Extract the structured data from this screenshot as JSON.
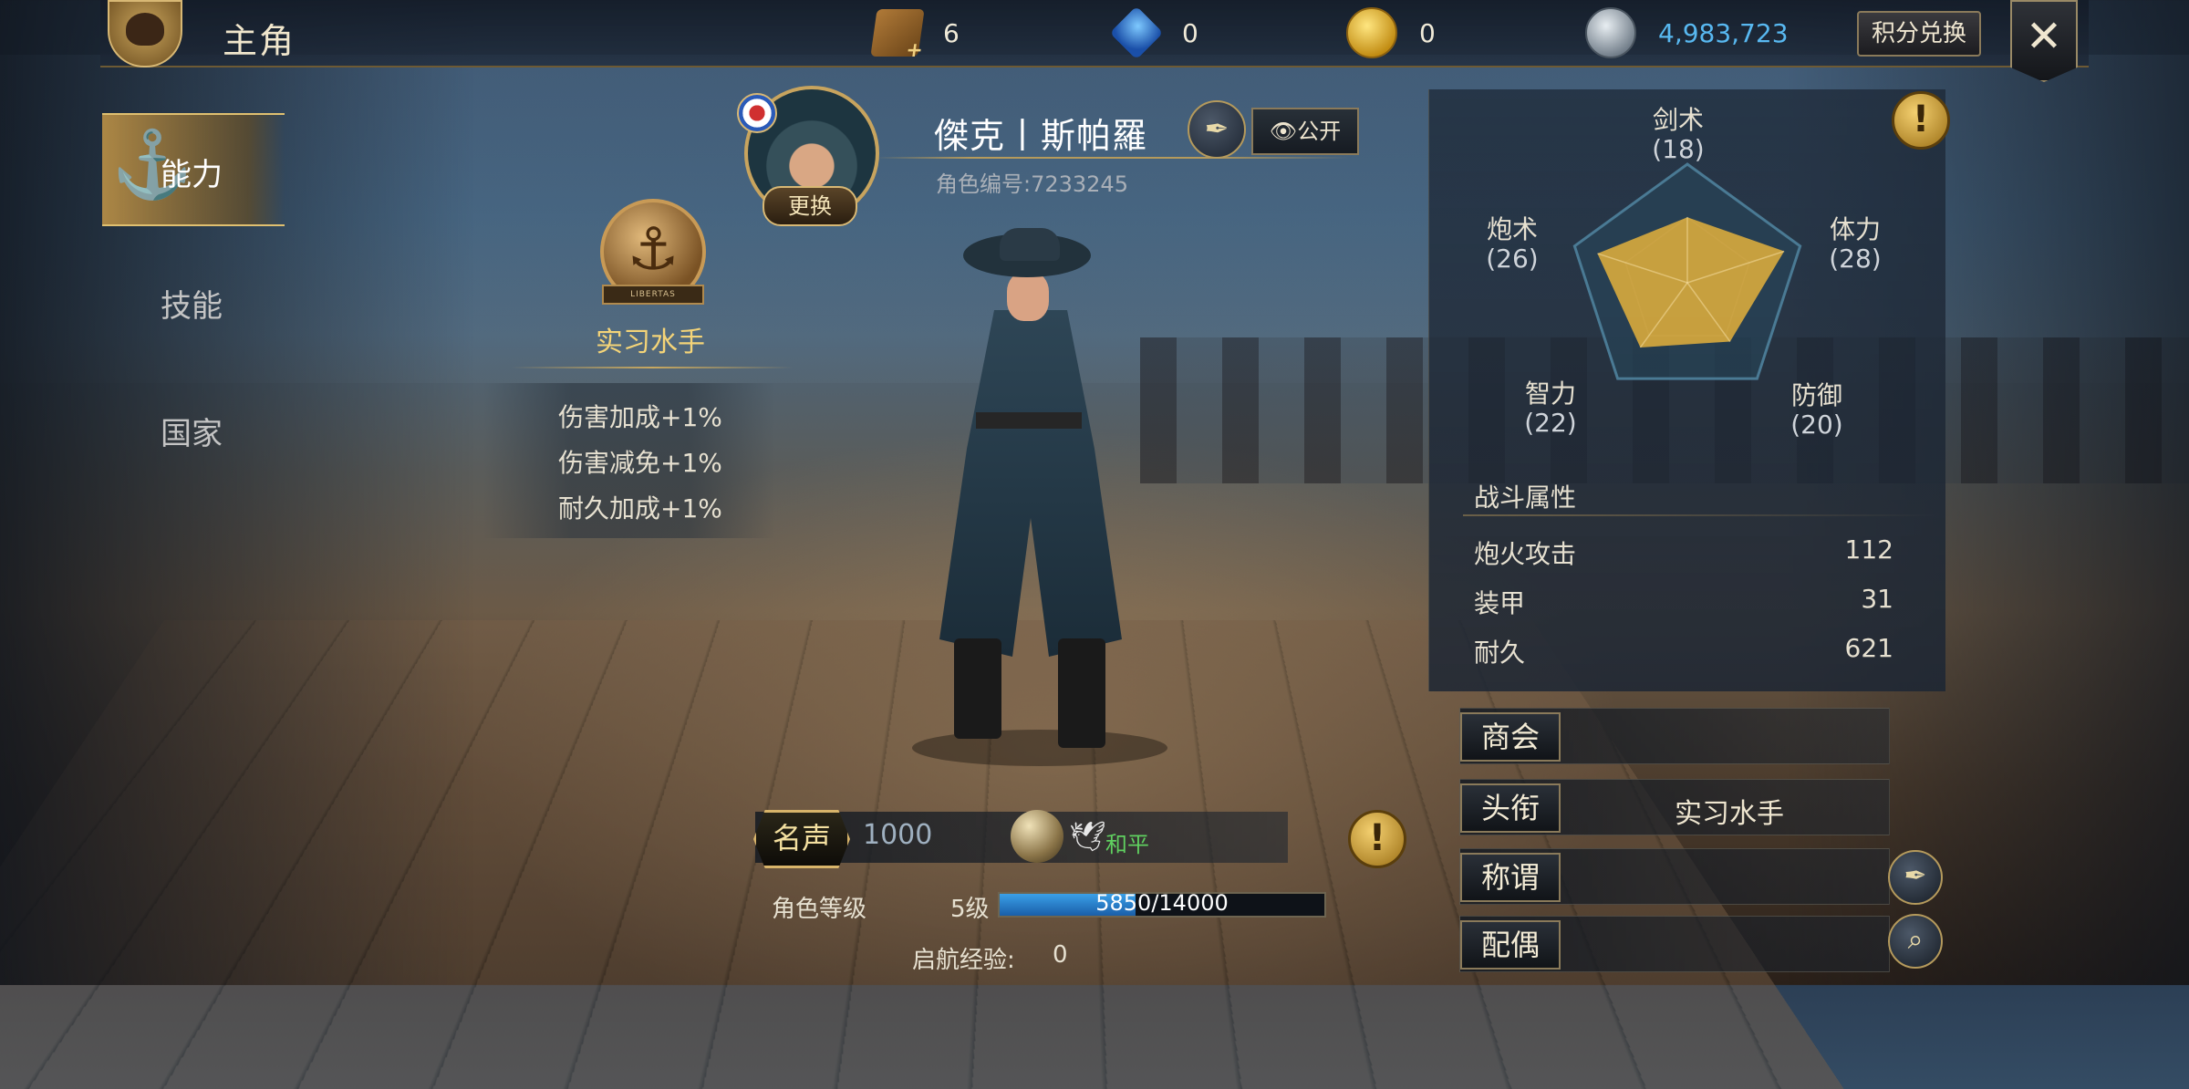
{
  "header": {
    "title": "主角",
    "exchange_label": "积分兑换",
    "close_label": "✕"
  },
  "resources": [
    {
      "icon": "chest-icon",
      "value": "6"
    },
    {
      "icon": "gem-icon",
      "value": "0"
    },
    {
      "icon": "coin-icon",
      "value": "0"
    },
    {
      "icon": "silver-coin-icon",
      "value": "4,983,723"
    }
  ],
  "nav": {
    "items": [
      {
        "label": "能力",
        "active": true
      },
      {
        "label": "技能",
        "active": false
      },
      {
        "label": "国家",
        "active": false
      }
    ]
  },
  "rank": {
    "badge_text": "LIBERTAS",
    "name": "实习水手",
    "bonuses": [
      "伤害加成+1%",
      "伤害减免+1%",
      "耐久加成+1%"
    ]
  },
  "character": {
    "name": "傑克丨斯帕羅",
    "id_text": "角色编号:7233245",
    "change_label": "更换",
    "public_label": "公开"
  },
  "radar": {
    "labels": [
      {
        "name": "剑术",
        "value": "(18)"
      },
      {
        "name": "体力",
        "value": "(28)"
      },
      {
        "name": "防御",
        "value": "(20)"
      },
      {
        "name": "智力",
        "value": "(22)"
      },
      {
        "name": "炮术",
        "value": "(26)"
      }
    ],
    "values": [
      18,
      28,
      20,
      22,
      26
    ],
    "max": 30
  },
  "combat": {
    "title": "战斗属性",
    "rows": [
      {
        "label": "炮火攻击",
        "value": "112"
      },
      {
        "label": "装甲",
        "value": "31"
      },
      {
        "label": "耐久",
        "value": "621"
      }
    ]
  },
  "info_rows": [
    {
      "tag": "商会",
      "value": ""
    },
    {
      "tag": "头衔",
      "value": "实习水手"
    },
    {
      "tag": "称谓",
      "value": ""
    },
    {
      "tag": "配偶",
      "value": ""
    }
  ],
  "fame": {
    "label": "名声",
    "value": "1000",
    "status": "和平"
  },
  "level": {
    "label": "角色等级",
    "level_text": "5级",
    "xp_current": 5850,
    "xp_max": 14000,
    "xp_text": "5850/14000"
  },
  "sail": {
    "label": "启航经验:",
    "value": "0"
  },
  "colors": {
    "accent_gold": "#d8b874",
    "radar_fill": "#d6a83e",
    "xp_blue": "#2a86d8",
    "peace_green": "#60d060"
  }
}
